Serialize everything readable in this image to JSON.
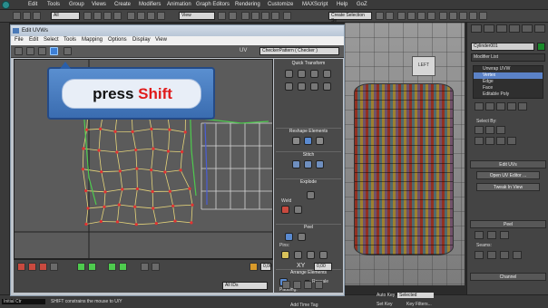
{
  "menubar": {
    "items": [
      "Edit",
      "Tools",
      "Group",
      "Views",
      "Create",
      "Modifiers",
      "Animation",
      "Graph Editors",
      "Rendering",
      "Customize",
      "MAXScript",
      "Help",
      "GoZ"
    ]
  },
  "toolbar": {
    "selection_filter": "All",
    "view_combo": "View",
    "named_sel": "Create Selection Se"
  },
  "uv_window": {
    "title": "Edit UVWs",
    "menu": [
      "File",
      "Edit",
      "Select",
      "Tools",
      "Mapping",
      "Options",
      "Display",
      "View"
    ],
    "uv_label": "UV",
    "texture_combo": "CheckerPattern  ( Checker )"
  },
  "callout": {
    "prefix": "press ",
    "key": "Shift"
  },
  "uv_panel": {
    "quick_transform": "Quick Transform",
    "reshape": "Reshape Elements",
    "stitch": "Stitch",
    "explode": "Explode",
    "weld": "Weld",
    "peel": "Peel",
    "pins": "Pins:",
    "arrange": "Arrange Elements",
    "rescale": "Rescale",
    "padding": "Padding:"
  },
  "uv_bottom": {
    "coord_u": "0,00",
    "coord_v": "0,00",
    "xy": "XY",
    "ids_combo": "All IDs",
    "value": "0,00"
  },
  "viewport": {
    "box_label": "LEFT"
  },
  "command_panel": {
    "object_name": "Cylinder001",
    "modifier_list": "Modifier List",
    "stack": [
      {
        "label": "Unwrap UVW",
        "selected": false
      },
      {
        "label": "Vertex",
        "selected": true
      },
      {
        "label": "Edge",
        "selected": false
      },
      {
        "label": "Face",
        "selected": false
      },
      {
        "label": "Editable Poly",
        "selected": false
      }
    ],
    "select_by": "Select By:",
    "edit_uvs": "Edit UVs",
    "open_uv_editor": "Open UV Editor ...",
    "tweak_in_view": "Tweak In View",
    "peel": "Peel",
    "seams": "Seams:",
    "channel": "Channel"
  },
  "statusbar": {
    "maxscript": "Initial Ctr",
    "prompt": "SHIFT constrains the mouse to U/Y",
    "add_time_tag": "Add Time Tag",
    "auto_key": "Auto Key",
    "set_key": "Set Key",
    "selected": "Selected",
    "key_filters": "Key Filters..."
  }
}
